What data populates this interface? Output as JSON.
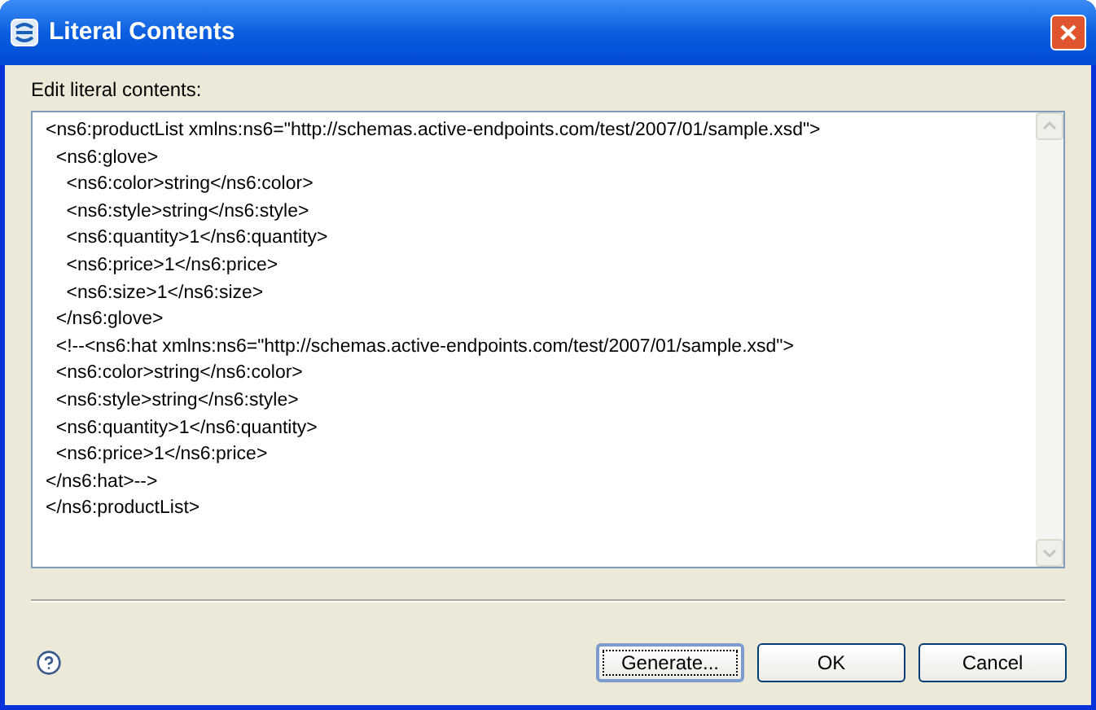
{
  "window": {
    "title": "Literal Contents"
  },
  "label": "Edit literal contents:",
  "editor": {
    "lines": [
      "<ns6:productList xmlns:ns6=\"http://schemas.active-endpoints.com/test/2007/01/sample.xsd\">",
      "  <ns6:glove>",
      "    <ns6:color>string</ns6:color>",
      "    <ns6:style>string</ns6:style>",
      "    <ns6:quantity>1</ns6:quantity>",
      "    <ns6:price>1</ns6:price>",
      "    <ns6:size>1</ns6:size>",
      "  </ns6:glove>",
      "  <!--<ns6:hat xmlns:ns6=\"http://schemas.active-endpoints.com/test/2007/01/sample.xsd\">",
      "  <ns6:color>string</ns6:color>",
      "  <ns6:style>string</ns6:style>",
      "  <ns6:quantity>1</ns6:quantity>",
      "  <ns6:price>1</ns6:price>",
      "</ns6:hat>-->",
      "</ns6:productList>"
    ]
  },
  "buttons": [
    {
      "label": "Generate...",
      "focused": true
    },
    {
      "label": "OK",
      "focused": false
    },
    {
      "label": "Cancel",
      "focused": false
    }
  ]
}
